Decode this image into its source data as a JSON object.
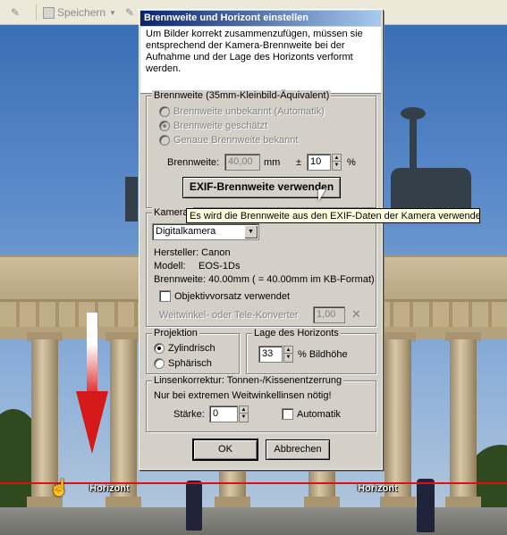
{
  "toolbar": {
    "save_label": "Speichern"
  },
  "photo": {
    "horizon_label_left": "Horizont",
    "horizon_label_right": "Horizont"
  },
  "dialog": {
    "title": "Brennweite und Horizont einstellen",
    "intro": "Um Bilder korrekt zusammenzufügen, müssen sie entsprechend der Kamera-Brennweite bei der Aufnahme und der Lage des Horizonts verformt werden.",
    "focal_group": {
      "legend": "Brennweite (35mm-Kleinbild-Äquivalent)",
      "options": [
        {
          "label": "Brennweite unbekannt (Automatik)",
          "selected": false
        },
        {
          "label": "Brennweite geschätzt",
          "selected": true
        },
        {
          "label": "Genaue Brennweite bekannt",
          "selected": false
        }
      ],
      "focal_label": "Brennweite:",
      "focal_value": "40,00",
      "focal_unit": "mm",
      "tolerance_label": "±",
      "tolerance_value": "10",
      "tolerance_unit": "%",
      "exif_button": "EXIF-Brennweite verwenden"
    },
    "tooltip": "Es wird die Brennweite aus den EXIF-Daten der Kamera verwendet.",
    "camera_group": {
      "legend": "Kamerat",
      "camera_type": "Digitalkamera",
      "maker_line": "Hersteller: Canon",
      "model_label": "Modell:",
      "model_value": "EOS-1Ds",
      "focal_line": "Brennweite: 40.00mm ( = 40.00mm im KB-Format)",
      "lens_attachment_label": "Objektivvorsatz verwendet",
      "converter_label": "Weitwinkel- oder Tele-Konverter",
      "converter_value": "1,00",
      "converter_clear": "✕"
    },
    "projection_group": {
      "legend": "Projektion",
      "options": [
        {
          "label": "Zylindrisch",
          "selected": true
        },
        {
          "label": "Sphärisch",
          "selected": false
        }
      ]
    },
    "horizon_group": {
      "legend": "Lage des Horizonts",
      "value": "33",
      "unit": "% Bildhöhe"
    },
    "lens_group": {
      "legend": "Linsenkorrektur: Tonnen-/Kissenentzerrung",
      "hint": "Nur bei extremen Weitwinkellinsen nötig!",
      "strength_label": "Stärke:",
      "strength_value": "0",
      "auto_label": "Automatik"
    },
    "ok_label": "OK",
    "cancel_label": "Abbrechen"
  }
}
